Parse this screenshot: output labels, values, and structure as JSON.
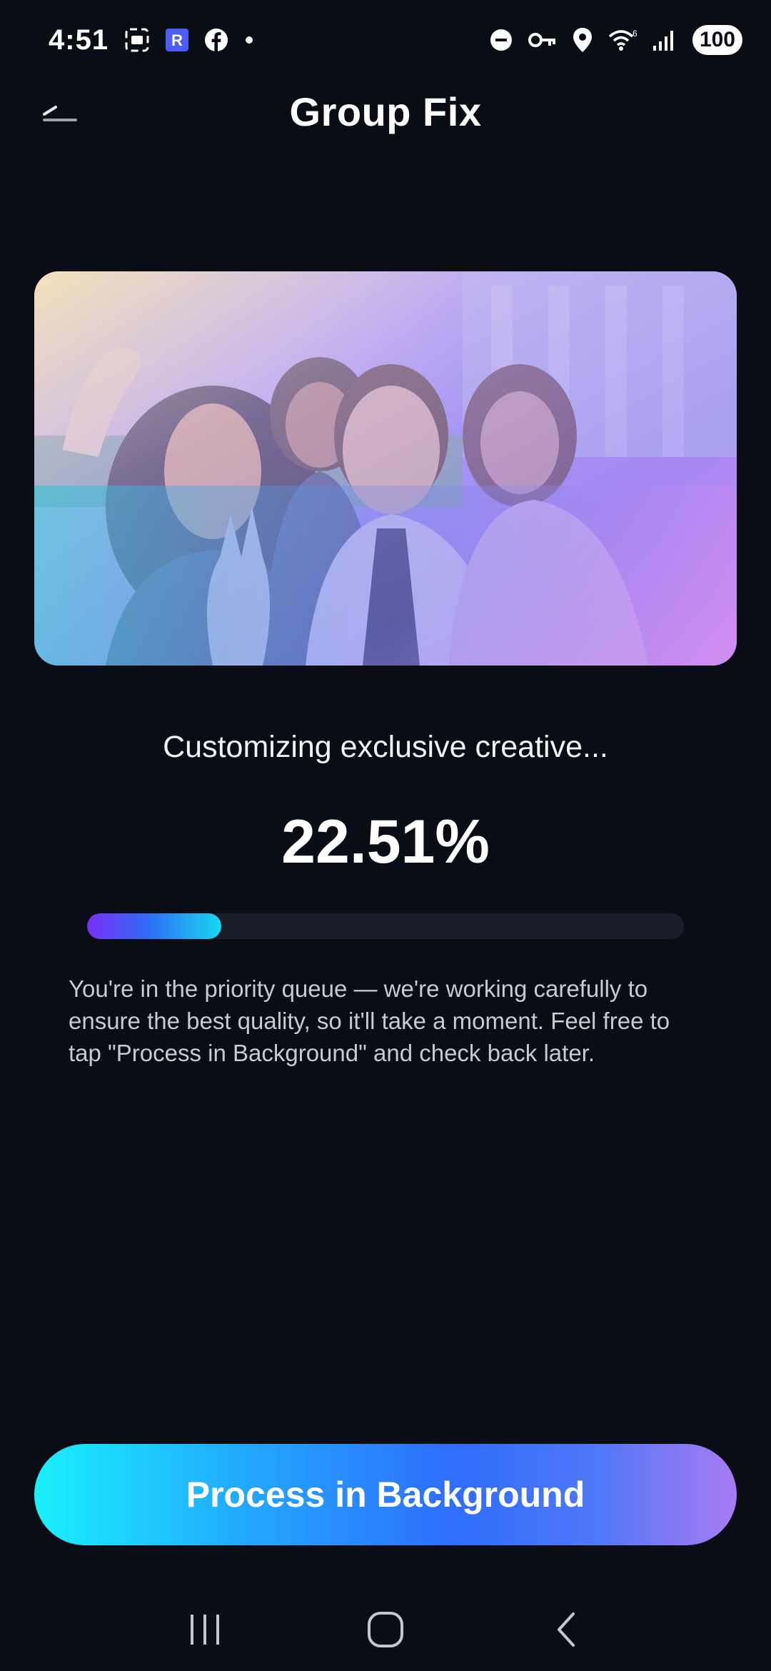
{
  "status_bar": {
    "time": "4:51",
    "battery": "100",
    "left_icons": [
      "screenshot-icon",
      "app-r-icon",
      "facebook-icon",
      "dot-icon"
    ],
    "right_icons": [
      "do-not-disturb-icon",
      "vpn-key-icon",
      "location-icon",
      "wifi-icon",
      "signal-icon"
    ]
  },
  "header": {
    "title": "Group Fix",
    "back_icon": "back-icon"
  },
  "processing": {
    "status_text": "Customizing exclusive creative...",
    "percent_label": "22.51%",
    "progress": 0.2251,
    "info": "You're in the priority queue — we're working carefully to ensure the best quality, so it'll take a moment. Feel free to tap \"Process in Background\" and check back later."
  },
  "actions": {
    "process_button_label": "Process in Background"
  },
  "nav": {
    "recents_icon": "recents-icon",
    "home_icon": "home-icon",
    "back_icon": "nav-back-icon"
  },
  "colors": {
    "background": "#0a0d16",
    "progress_start": "#7b2ff7",
    "progress_end": "#18d8f0",
    "button_start": "#19f0fb",
    "button_end": "#a97af3"
  }
}
